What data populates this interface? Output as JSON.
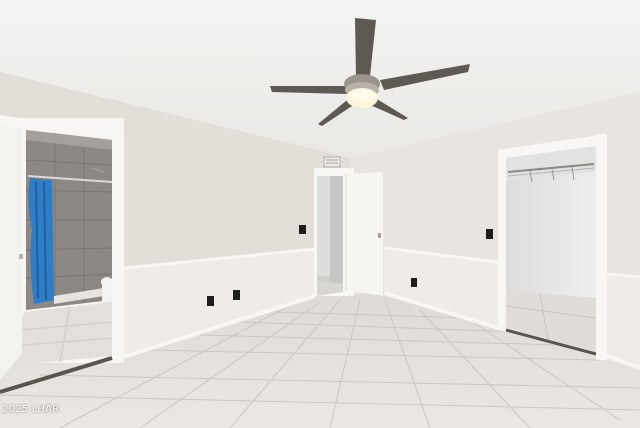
{
  "watermark": "2025 LHAR",
  "colors": {
    "ceiling": "#eeeeec",
    "wall_left": "#e6e0db",
    "wall_right": "#e9e4df",
    "wainscot": "#f1eeea",
    "floor_tile": "#e2ded9",
    "grout": "#cfc9c3",
    "trim": "#f8f7f5",
    "fan_blade": "#5b5650",
    "tub_curtain": "#2f7dc4",
    "bath_tile": "#8c8782"
  },
  "icons": [
    "ceiling-fan-icon",
    "light-switch-icon",
    "outlet-icon",
    "hvac-vent-icon"
  ]
}
